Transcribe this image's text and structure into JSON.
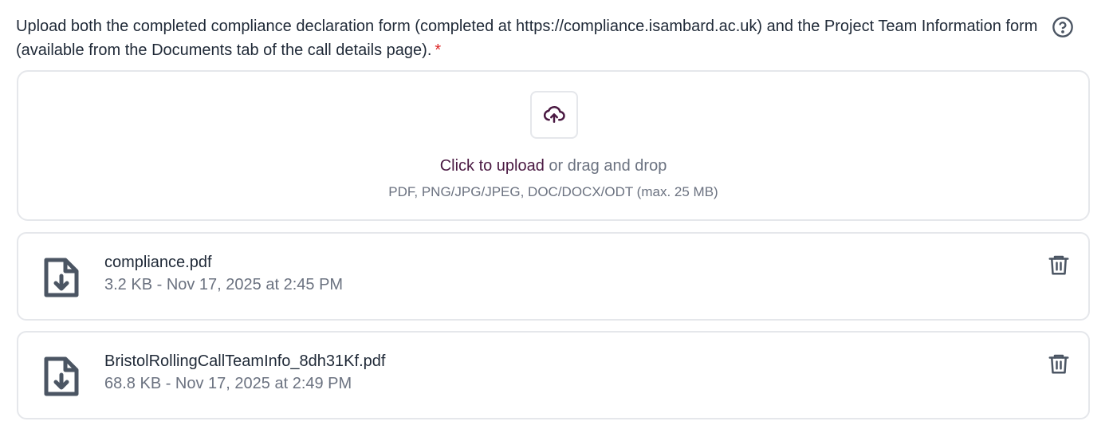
{
  "field": {
    "label": "Upload both the completed compliance declaration form (completed at https://compliance.isambard.ac.uk) and the Project Team Information form (available from the Documents tab of the call details page).",
    "required_mark": "*",
    "help_icon": "help-circle-icon"
  },
  "dropzone": {
    "upload_icon": "cloud-upload-icon",
    "link_text": "Click to upload",
    "rest_text": " or drag and drop",
    "hint": "PDF, PNG/JPG/JPEG, DOC/DOCX/ODT (max. 25 MB)"
  },
  "files": [
    {
      "name": "compliance.pdf",
      "meta": "3.2 KB - Nov 17, 2025 at 2:45 PM",
      "icon": "file-download-icon",
      "delete_icon": "trash-icon"
    },
    {
      "name": "BristolRollingCallTeamInfo_8dh31Kf.pdf",
      "meta": "68.8 KB - Nov 17, 2025 at 2:49 PM",
      "icon": "file-download-icon",
      "delete_icon": "trash-icon"
    }
  ],
  "colors": {
    "accent": "#4a1942",
    "required": "#dc2626",
    "icon_gray": "#4b5563",
    "border": "#e5e7eb",
    "muted_text": "#6b7280"
  }
}
